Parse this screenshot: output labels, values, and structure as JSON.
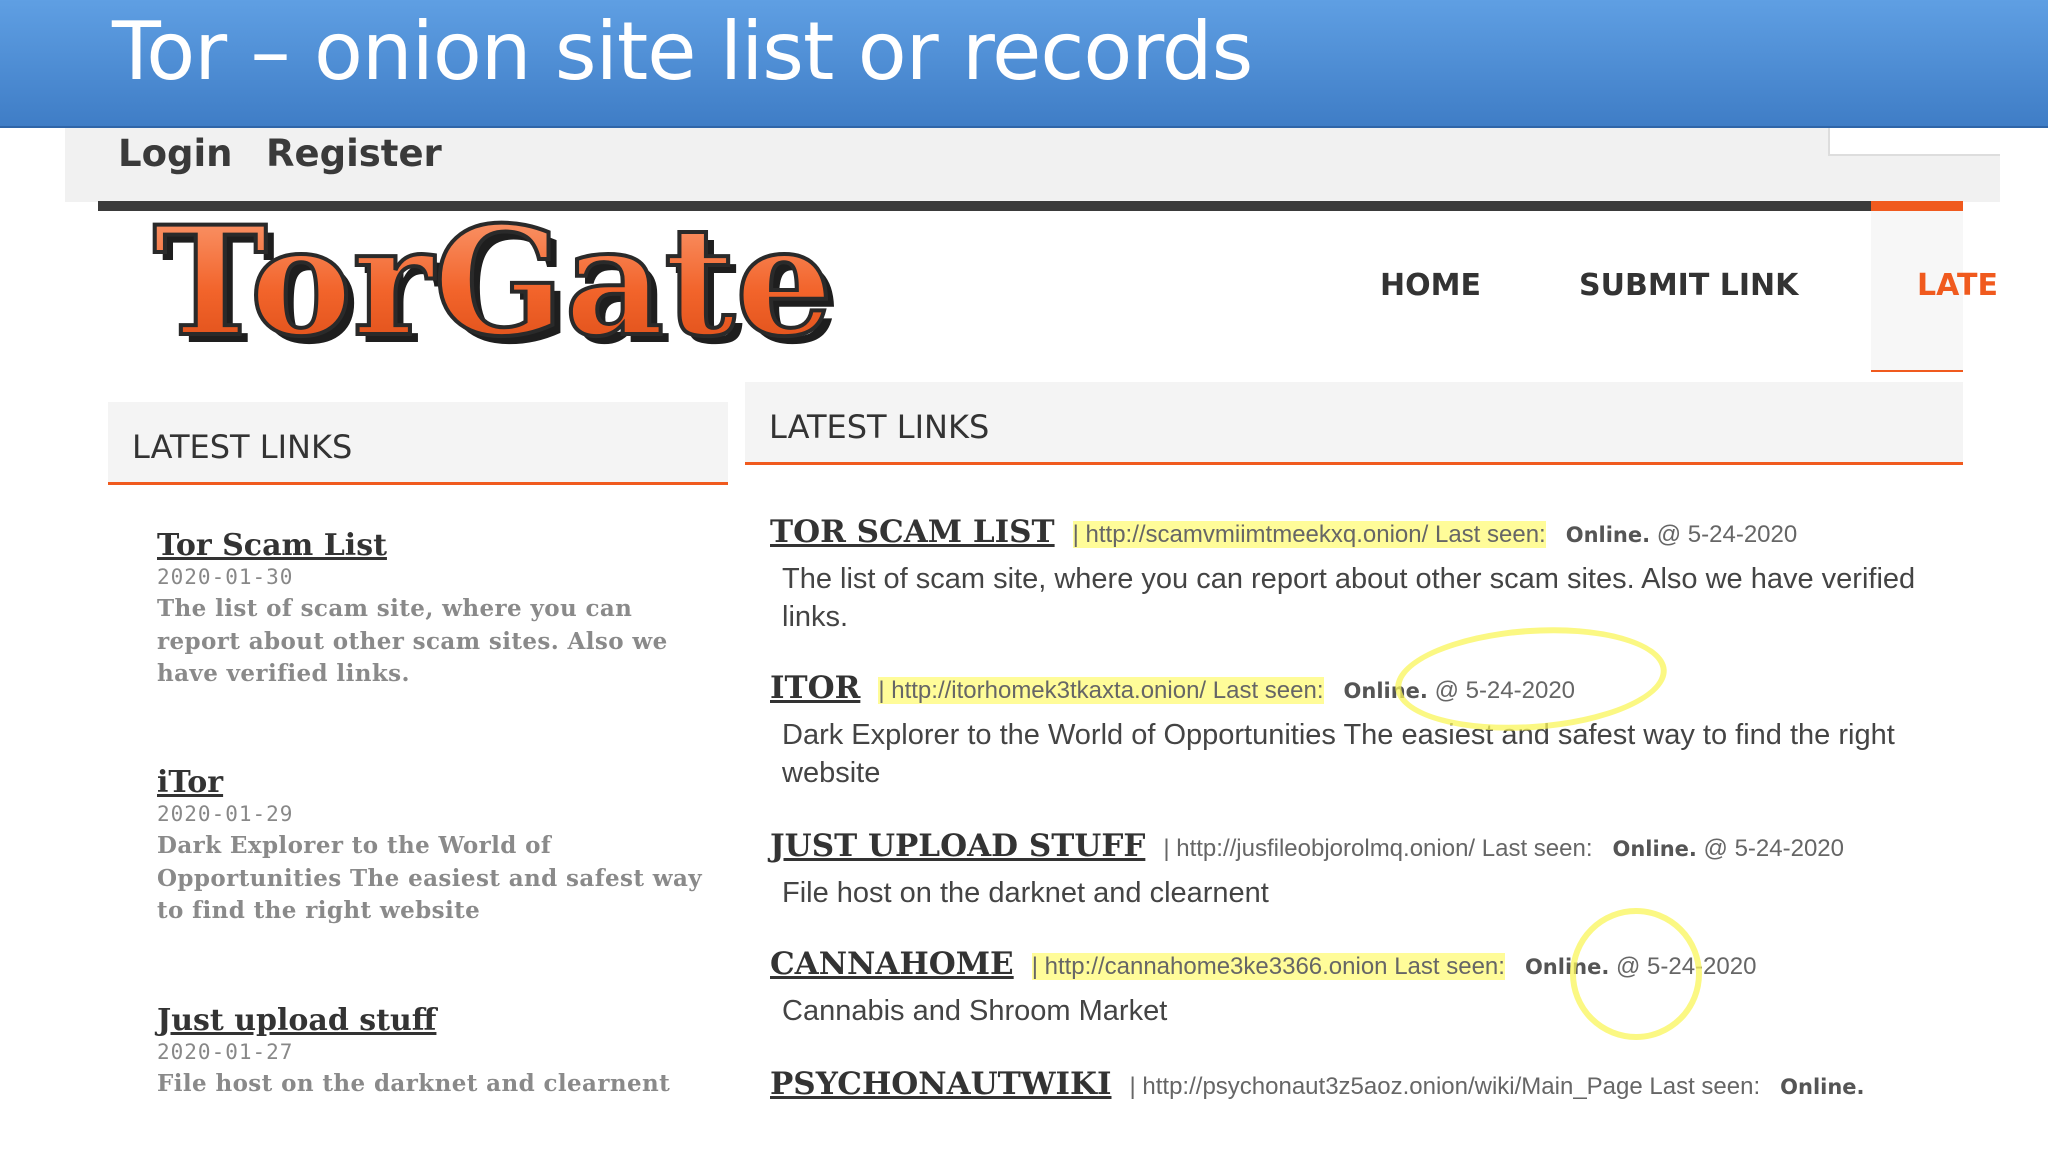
{
  "slide": {
    "title": "Tor – onion site list or records"
  },
  "topbar": {
    "login": "Login",
    "register": "Register"
  },
  "logo": {
    "text": "TorGate"
  },
  "nav": {
    "home": "HOME",
    "submit": "SUBMIT LINK",
    "latest": "LATE"
  },
  "sidebar": {
    "heading": "LATEST LINKS",
    "items": [
      {
        "title": "Tor Scam List",
        "date": "2020-01-30",
        "summary": "The list of scam site, where you can report about other scam sites. Also we have verified links."
      },
      {
        "title": "iTor",
        "date": "2020-01-29",
        "summary": "Dark Explorer to the World of Opportunities The easiest and safest way to find the right website"
      },
      {
        "title": "Just upload stuff",
        "date": "2020-01-27",
        "summary": "File host on the darknet and clearnent"
      }
    ]
  },
  "main": {
    "heading": "LATEST LINKS",
    "entries": [
      {
        "name": "TOR SCAM LIST",
        "url": "| http://scamvmiimtmeekxq.onion/ Last seen:",
        "status": "Online.",
        "date": "@ 5-24-2020",
        "desc": "The list of scam site, where you can report about other scam sites. Also we have verified links."
      },
      {
        "name": "ITOR",
        "url": "| http://itorhomek3tkaxta.onion/ Last seen:",
        "status": "Online.",
        "date": "@ 5-24-2020",
        "desc": "Dark Explorer to the World of Opportunities The easiest and safest way to find the right website"
      },
      {
        "name": "JUST UPLOAD STUFF",
        "url": "| http://jusfileobjorolmq.onion/ Last seen:",
        "status": "Online.",
        "date": "@ 5-24-2020",
        "desc": "File host on the darknet and clearnent"
      },
      {
        "name": "CANNAHOME",
        "url": "| http://cannahome3ke3366.onion Last seen:",
        "status": "Online.",
        "date": "@ 5-24-2020",
        "desc": "Cannabis and Shroom Market"
      },
      {
        "name": "PSYCHONAUTWIKI",
        "url": "| http://psychonaut3z5aoz.onion/wiki/Main_Page Last seen:",
        "status": "Online.",
        "date": "",
        "desc": ""
      }
    ]
  },
  "colors": {
    "accent": "#f05a1e",
    "header_blue": "#4a8ad4",
    "highlight": "#fff94a"
  }
}
